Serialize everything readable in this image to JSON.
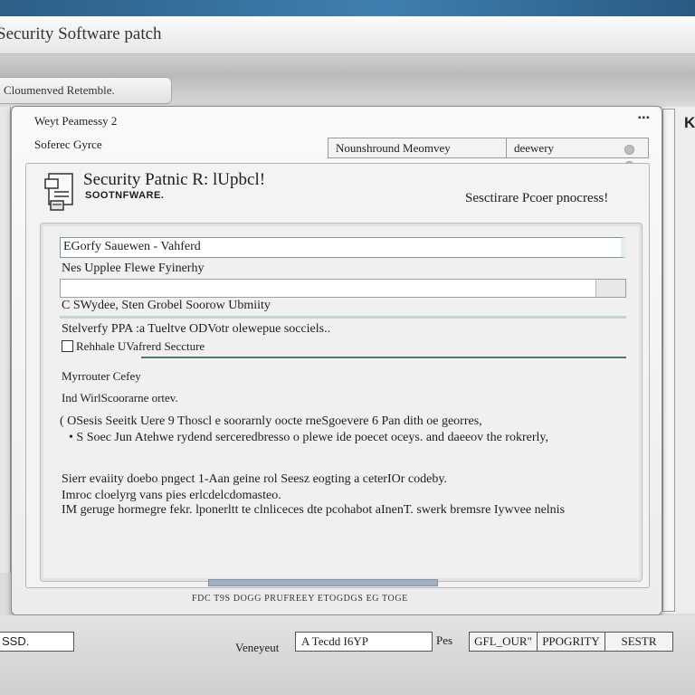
{
  "app": {
    "title": "Security  Software patch"
  },
  "tabs": [
    {
      "label": "Cloumenved Retemble."
    }
  ],
  "dialog": {
    "title": "Weyt Peamessy 2",
    "window_controls": "▪▪▪",
    "subtitle": "Soferec Gyrce",
    "field_left": "Nounshround Meomvey",
    "field_right": "deewery"
  },
  "header": {
    "title": "Security Patnic R: lUpbcl!",
    "subtitle": "SOOTNFWARE.",
    "status": "Sesctirare Pcoer pnocress!"
  },
  "form": {
    "input1_value": "EGorfy Sauewen - Vahferd",
    "label2": "Nes  Upplee Flewe Fyinerhy",
    "label3": "C SWydee, Sten Grobel Soorow Ubmiity",
    "label4": "Stelverfy PPA :a Tueltve ODVotr olewepue socciels..",
    "checkbox_label": "Rehhale UVafrerd Seccture",
    "label5": "Myrrouter Cefey",
    "label6": "Ind WirlScoorarne ortev.",
    "bullet1": "( OSesis Seeitk Uere  9  Thoscl e soorarnly oocte rneSgoevere 6 Pan  dith  oe georres,",
    "bullet2": "•  S Soec Jun Atehwe rydend serceredbresso o plewe ide poecet oceys. and daeeov the rokrerly,",
    "para1": "Sierr evaiity doebo pngect  1-Aan geine rol Seesz eogting a ceterIOr codeby.",
    "para2": "Imroc cloelyrg vans pies erlcdelcdomasteo.",
    "para3": "IM geruge hormegre fekr. lponerltt te clnliceces dte pcohabot aInenT. swerk bremsre Iywvee nelnis",
    "progress": 1,
    "footnote": "FDC  T9S  DOGG  PRUFREEY  ETOGDGS  EG  TOGE"
  },
  "bottom": {
    "field1": "SSD.",
    "label_left": "Veneyeut",
    "field2": "A Tecdd  I6YP",
    "label_mid": "Pes",
    "buttons": [
      "GFL_OUR\"",
      "PPOGRITY",
      "SESTR"
    ]
  },
  "right_panel_label": "K"
}
